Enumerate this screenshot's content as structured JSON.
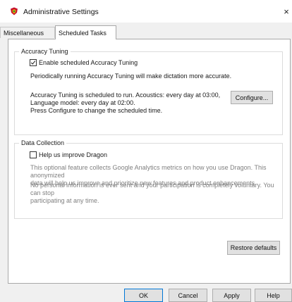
{
  "window": {
    "title": "Administrative Settings",
    "close_glyph": "×"
  },
  "tabs": [
    {
      "label": "Miscellaneous",
      "selected": false
    },
    {
      "label": "Scheduled Tasks",
      "selected": true
    }
  ],
  "accuracy_tuning": {
    "legend": "Accuracy Tuning",
    "enable_label": "Enable scheduled Accuracy Tuning",
    "enable_checked": true,
    "description": "Periodically running Accuracy Tuning will make dictation more accurate.",
    "schedule_lines": [
      "Accuracy Tuning is scheduled to run. Acoustics: every day at 03:00,",
      "Language model: every day at 02:00.",
      "Press Configure to change the scheduled time."
    ],
    "configure_label": "Configure..."
  },
  "data_collection": {
    "legend": "Data Collection",
    "help_label": "Help us improve Dragon",
    "help_checked": false,
    "info_lines": [
      "This optional feature collects Google Analytics metrics on how you use Dragon. This anonymized",
      "data will help us improve and prioritize new features and product enhancements."
    ],
    "privacy_lines": [
      "No personal information is ever sent and your participation is completely voluntary. You can stop",
      "participating at any time."
    ]
  },
  "restore_label": "Restore defaults",
  "footer": {
    "ok_label": "OK",
    "cancel_label": "Cancel",
    "apply_label": "Apply",
    "help_label": "Help"
  },
  "icons": {
    "app": "dragon-shield-icon",
    "close": "close-icon",
    "check": "checkmark-icon"
  },
  "colors": {
    "accent_blue": "#0078d7",
    "dialog_bg": "#f0f0f0",
    "icon_red": "#c8102e",
    "icon_gold": "#e0b000",
    "icon_green": "#2e8b3a"
  }
}
